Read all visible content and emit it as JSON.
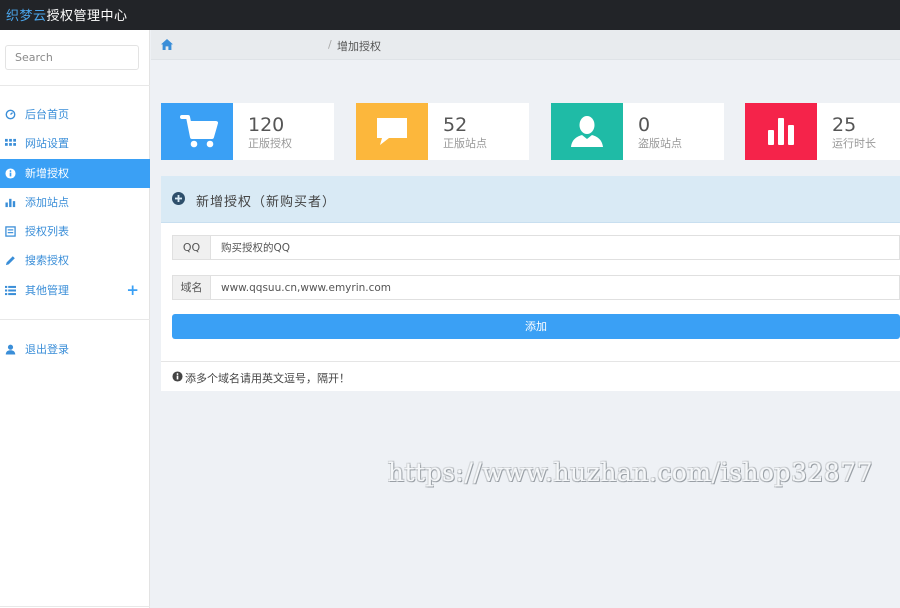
{
  "header": {
    "brand_accent": "织梦云",
    "brand_rest": "授权管理中心"
  },
  "sidebar": {
    "search_placeholder": "Search",
    "items": [
      {
        "label": "后台首页",
        "icon": "dashboard-icon",
        "active": false
      },
      {
        "label": "网站设置",
        "icon": "grid-icon",
        "active": false
      },
      {
        "label": "新增授权",
        "icon": "info-icon",
        "active": true
      },
      {
        "label": "添加站点",
        "icon": "bar-chart-icon",
        "active": false
      },
      {
        "label": "授权列表",
        "icon": "list-icon",
        "active": false
      },
      {
        "label": "搜索授权",
        "icon": "pencil-icon",
        "active": false
      },
      {
        "label": "其他管理",
        "icon": "list-icon",
        "active": false,
        "expand": "+"
      }
    ],
    "logout_label": "退出登录"
  },
  "breadcrumb": {
    "separator": "/",
    "current": "增加授权"
  },
  "stats": [
    {
      "value": "120",
      "label": "正版授权",
      "color": "#3aa0f5",
      "icon": "cart-icon"
    },
    {
      "value": "52",
      "label": "正版站点",
      "color": "#fcb73c",
      "icon": "comment-icon"
    },
    {
      "value": "0",
      "label": "盗版站点",
      "color": "#1fbba6",
      "icon": "user-icon"
    },
    {
      "value": "25",
      "label": "运行时长",
      "color": "#f5234a",
      "icon": "bar-chart-icon"
    }
  ],
  "form": {
    "title": "新增授权（新购买者）",
    "qq_label": "QQ",
    "qq_placeholder": "购买授权的QQ",
    "domain_label": "域名",
    "domain_placeholder": "www.qqsuu.cn,www.emyrin.com",
    "submit_label": "添加",
    "hint": "添多个域名请用英文逗号，隔开！"
  },
  "watermark": "https://www.huzhan.com/ishop32877",
  "colors": {
    "topbar": "#222428",
    "accent": "#3aa0f5",
    "panel_head": "#d9eaf5"
  }
}
